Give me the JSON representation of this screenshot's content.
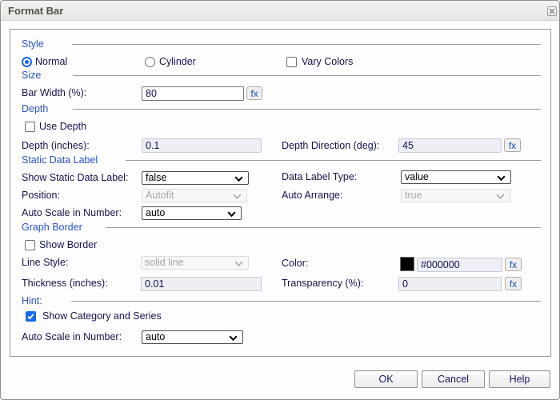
{
  "dialog": {
    "title": "Format Bar"
  },
  "fx_button_label": "fx",
  "style_section": {
    "header": "Style",
    "radio_normal": {
      "label": "Normal",
      "selected": true
    },
    "radio_cylinder": {
      "label": "Cylinder",
      "selected": false
    },
    "vary_colors": {
      "label": "Vary Colors",
      "checked": false
    }
  },
  "size_section": {
    "header": "Size",
    "bar_width": {
      "label": "Bar Width (%):",
      "value": "80"
    }
  },
  "depth_section": {
    "header": "Depth",
    "use_depth": {
      "label": "Use Depth",
      "checked": false
    },
    "depth_inches": {
      "label": "Depth (inches):",
      "value": "0.1"
    },
    "depth_direction": {
      "label": "Depth Direction (deg):",
      "value": "45"
    }
  },
  "static_data_label_section": {
    "header": "Static Data Label",
    "show_static_data_label": {
      "label": "Show Static Data Label:",
      "value": "false"
    },
    "data_label_type": {
      "label": "Data Label Type:",
      "value": "value"
    },
    "position": {
      "label": "Position:",
      "value": "Autofit",
      "disabled": true
    },
    "auto_arrange": {
      "label": "Auto Arrange:",
      "value": "true",
      "disabled": true
    },
    "auto_scale_in_number": {
      "label": "Auto Scale in Number:",
      "value": "auto"
    }
  },
  "graph_border_section": {
    "header": "Graph Border",
    "show_border": {
      "label": "Show Border",
      "checked": false
    },
    "line_style": {
      "label": "Line Style:",
      "value": "solid line",
      "disabled": true
    },
    "color": {
      "label": "Color:",
      "value": "#000000",
      "swatch": "#000000"
    },
    "thickness": {
      "label": "Thickness (inches):",
      "value": "0.01"
    },
    "transparency": {
      "label": "Transparency (%):",
      "value": "0"
    }
  },
  "hint_section": {
    "header": "Hint:",
    "show_category_and_series": {
      "label": "Show Category and Series",
      "checked": true
    },
    "auto_scale_in_number": {
      "label": "Auto Scale in Number:",
      "value": "auto"
    }
  },
  "buttons": {
    "ok": "OK",
    "cancel": "Cancel",
    "help": "Help"
  },
  "colors": {
    "section_header_blue": "#2a52c8",
    "label_navy": "#14144e",
    "accent_blue": "#1767f2",
    "swatch_black": "#000000"
  }
}
